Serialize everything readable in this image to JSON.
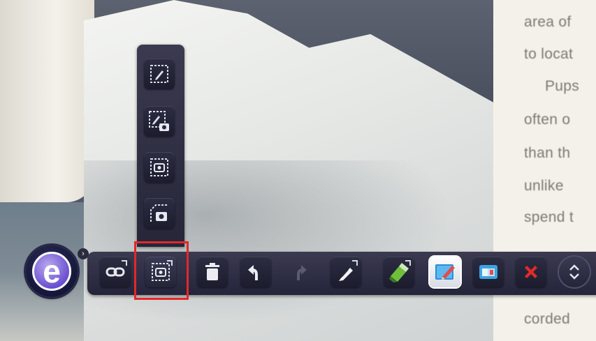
{
  "background": {
    "page_text_lines": [
      "area of",
      "to locat",
      "Pups",
      "often o",
      "than th",
      "unlike",
      "spend t",
      "corded"
    ]
  },
  "toolbar": {
    "logo_letter": "e",
    "logo_badge": "›",
    "buttons": [
      {
        "name": "link-button",
        "icon": "link-icon"
      },
      {
        "name": "screen-capture-button",
        "icon": "capture-screen-icon",
        "selected": true
      },
      {
        "name": "delete-button",
        "icon": "trash-icon"
      },
      {
        "name": "undo-button",
        "icon": "undo-icon"
      },
      {
        "name": "redo-button",
        "icon": "redo-icon",
        "disabled": true
      },
      {
        "name": "pen-button",
        "icon": "pen-icon"
      },
      {
        "name": "highlighter-button",
        "icon": "highlighter-icon"
      },
      {
        "name": "whiteboard-button",
        "icon": "whiteboard-icon",
        "active": true
      },
      {
        "name": "window-button",
        "icon": "window-icon"
      },
      {
        "name": "close-button",
        "icon": "close-icon"
      },
      {
        "name": "toggle-toolbar-button",
        "icon": "chevron-up-down-icon"
      }
    ],
    "capture_menu": [
      {
        "name": "annotate-region-option",
        "icon": "region-pen-icon"
      },
      {
        "name": "annotate-capture-option",
        "icon": "region-pen-camera-icon"
      },
      {
        "name": "capture-region-option",
        "icon": "region-camera-icon"
      },
      {
        "name": "capture-freeform-option",
        "icon": "freeform-camera-icon"
      }
    ],
    "colors": {
      "bar": "#2a2a3f",
      "highlight": "#e2282a",
      "close": "#e12a2a",
      "accent": "#3ca3e0"
    }
  }
}
